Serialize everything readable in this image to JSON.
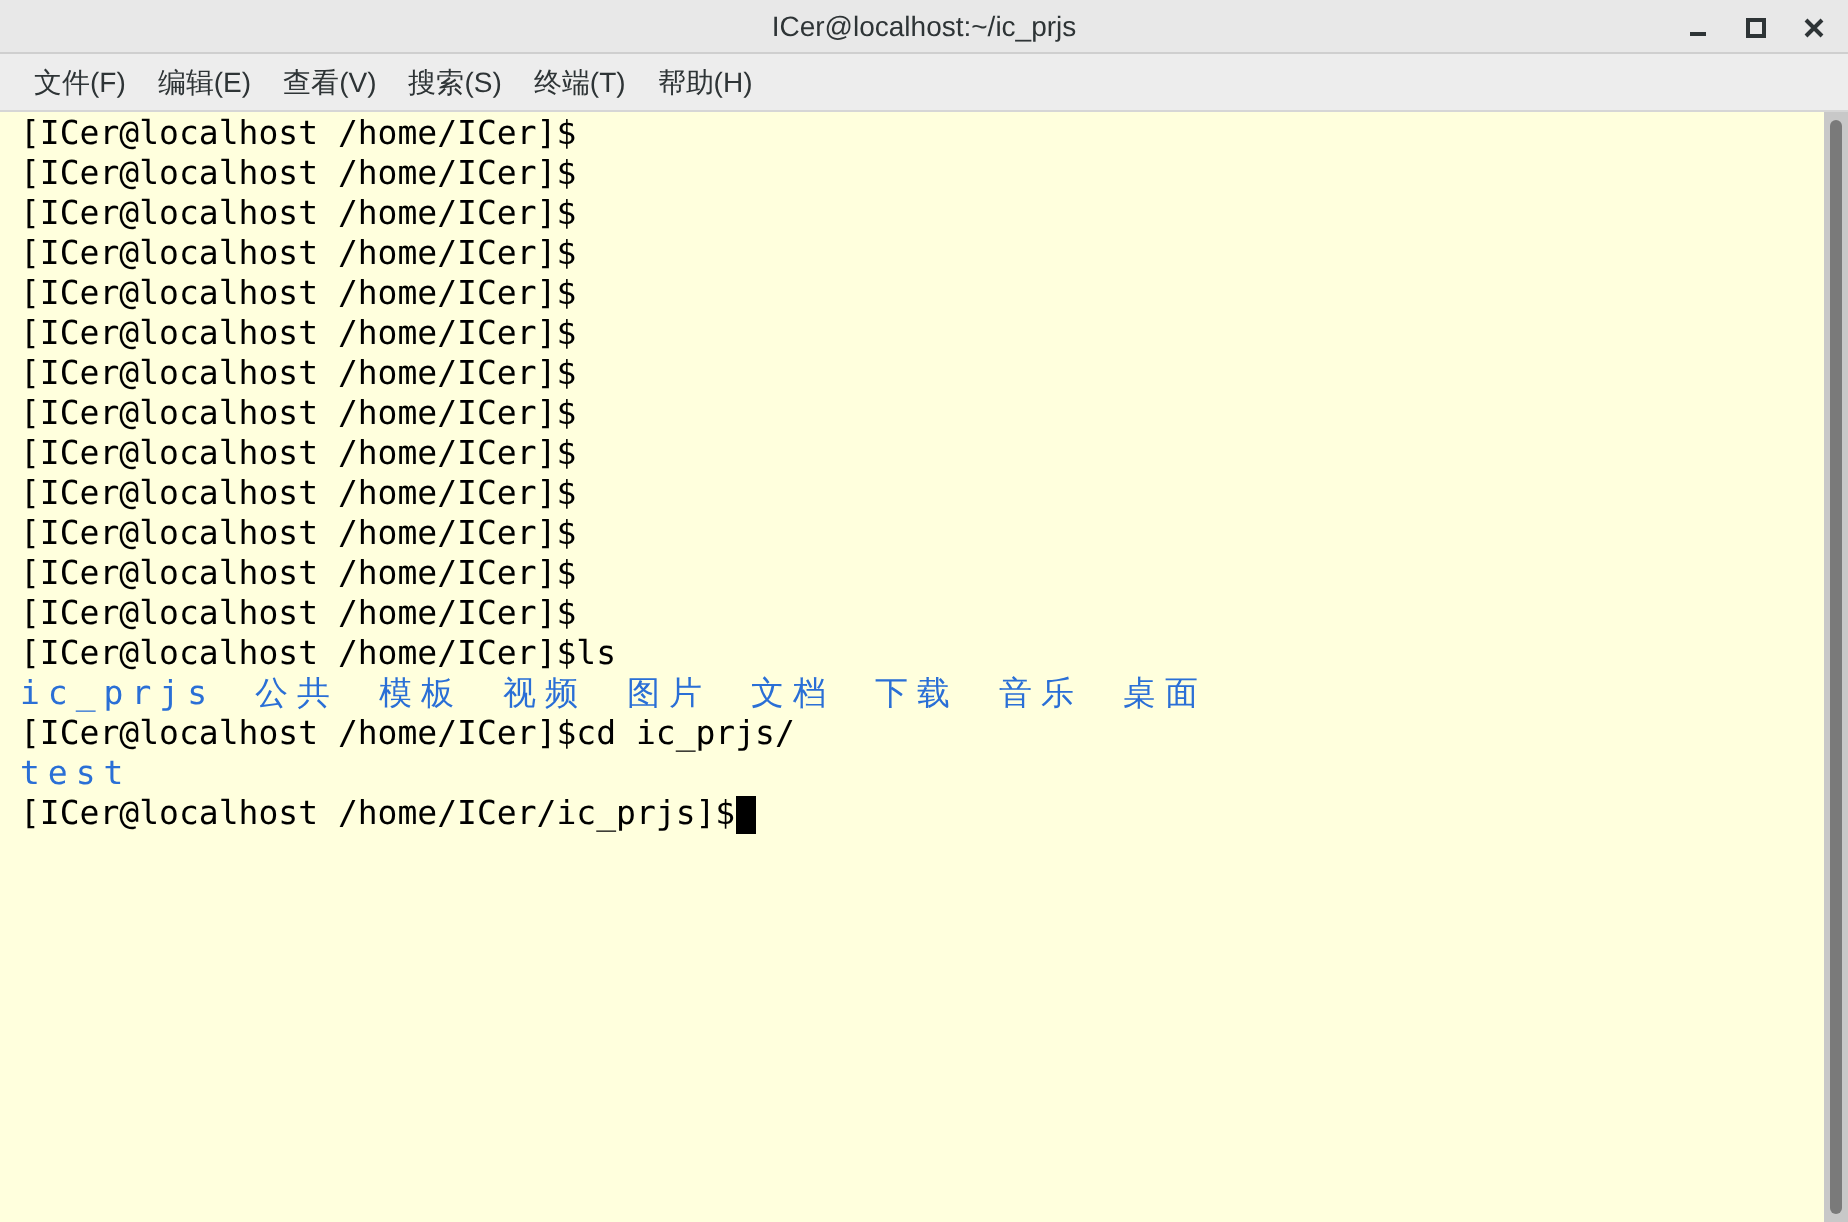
{
  "window": {
    "title": "ICer@localhost:~/ic_prjs"
  },
  "menu": [
    "文件(F)",
    "编辑(E)",
    "查看(V)",
    "搜索(S)",
    "终端(T)",
    "帮助(H)"
  ],
  "terminal": {
    "lines": [
      {
        "kind": "prompt",
        "text": "[ICer@localhost /home/ICer]$"
      },
      {
        "kind": "prompt",
        "text": "[ICer@localhost /home/ICer]$"
      },
      {
        "kind": "prompt",
        "text": "[ICer@localhost /home/ICer]$"
      },
      {
        "kind": "prompt",
        "text": "[ICer@localhost /home/ICer]$"
      },
      {
        "kind": "prompt",
        "text": "[ICer@localhost /home/ICer]$"
      },
      {
        "kind": "prompt",
        "text": "[ICer@localhost /home/ICer]$"
      },
      {
        "kind": "prompt",
        "text": "[ICer@localhost /home/ICer]$"
      },
      {
        "kind": "prompt",
        "text": "[ICer@localhost /home/ICer]$"
      },
      {
        "kind": "prompt",
        "text": "[ICer@localhost /home/ICer]$"
      },
      {
        "kind": "prompt",
        "text": "[ICer@localhost /home/ICer]$"
      },
      {
        "kind": "prompt",
        "text": "[ICer@localhost /home/ICer]$"
      },
      {
        "kind": "prompt",
        "text": "[ICer@localhost /home/ICer]$"
      },
      {
        "kind": "prompt",
        "text": "[ICer@localhost /home/ICer]$"
      },
      {
        "kind": "prompt",
        "text": "[ICer@localhost /home/ICer]$ls"
      },
      {
        "kind": "listing",
        "items": [
          "ic_prjs",
          "公共",
          "模板",
          "视频",
          "图片",
          "文档",
          "下载",
          "音乐",
          "桌面"
        ]
      },
      {
        "kind": "prompt",
        "text": "[ICer@localhost /home/ICer]$cd ic_prjs/"
      },
      {
        "kind": "listing",
        "items": [
          "test"
        ]
      },
      {
        "kind": "prompt",
        "text": "[ICer@localhost /home/ICer/ic_prjs]$",
        "cursor": true
      }
    ]
  }
}
